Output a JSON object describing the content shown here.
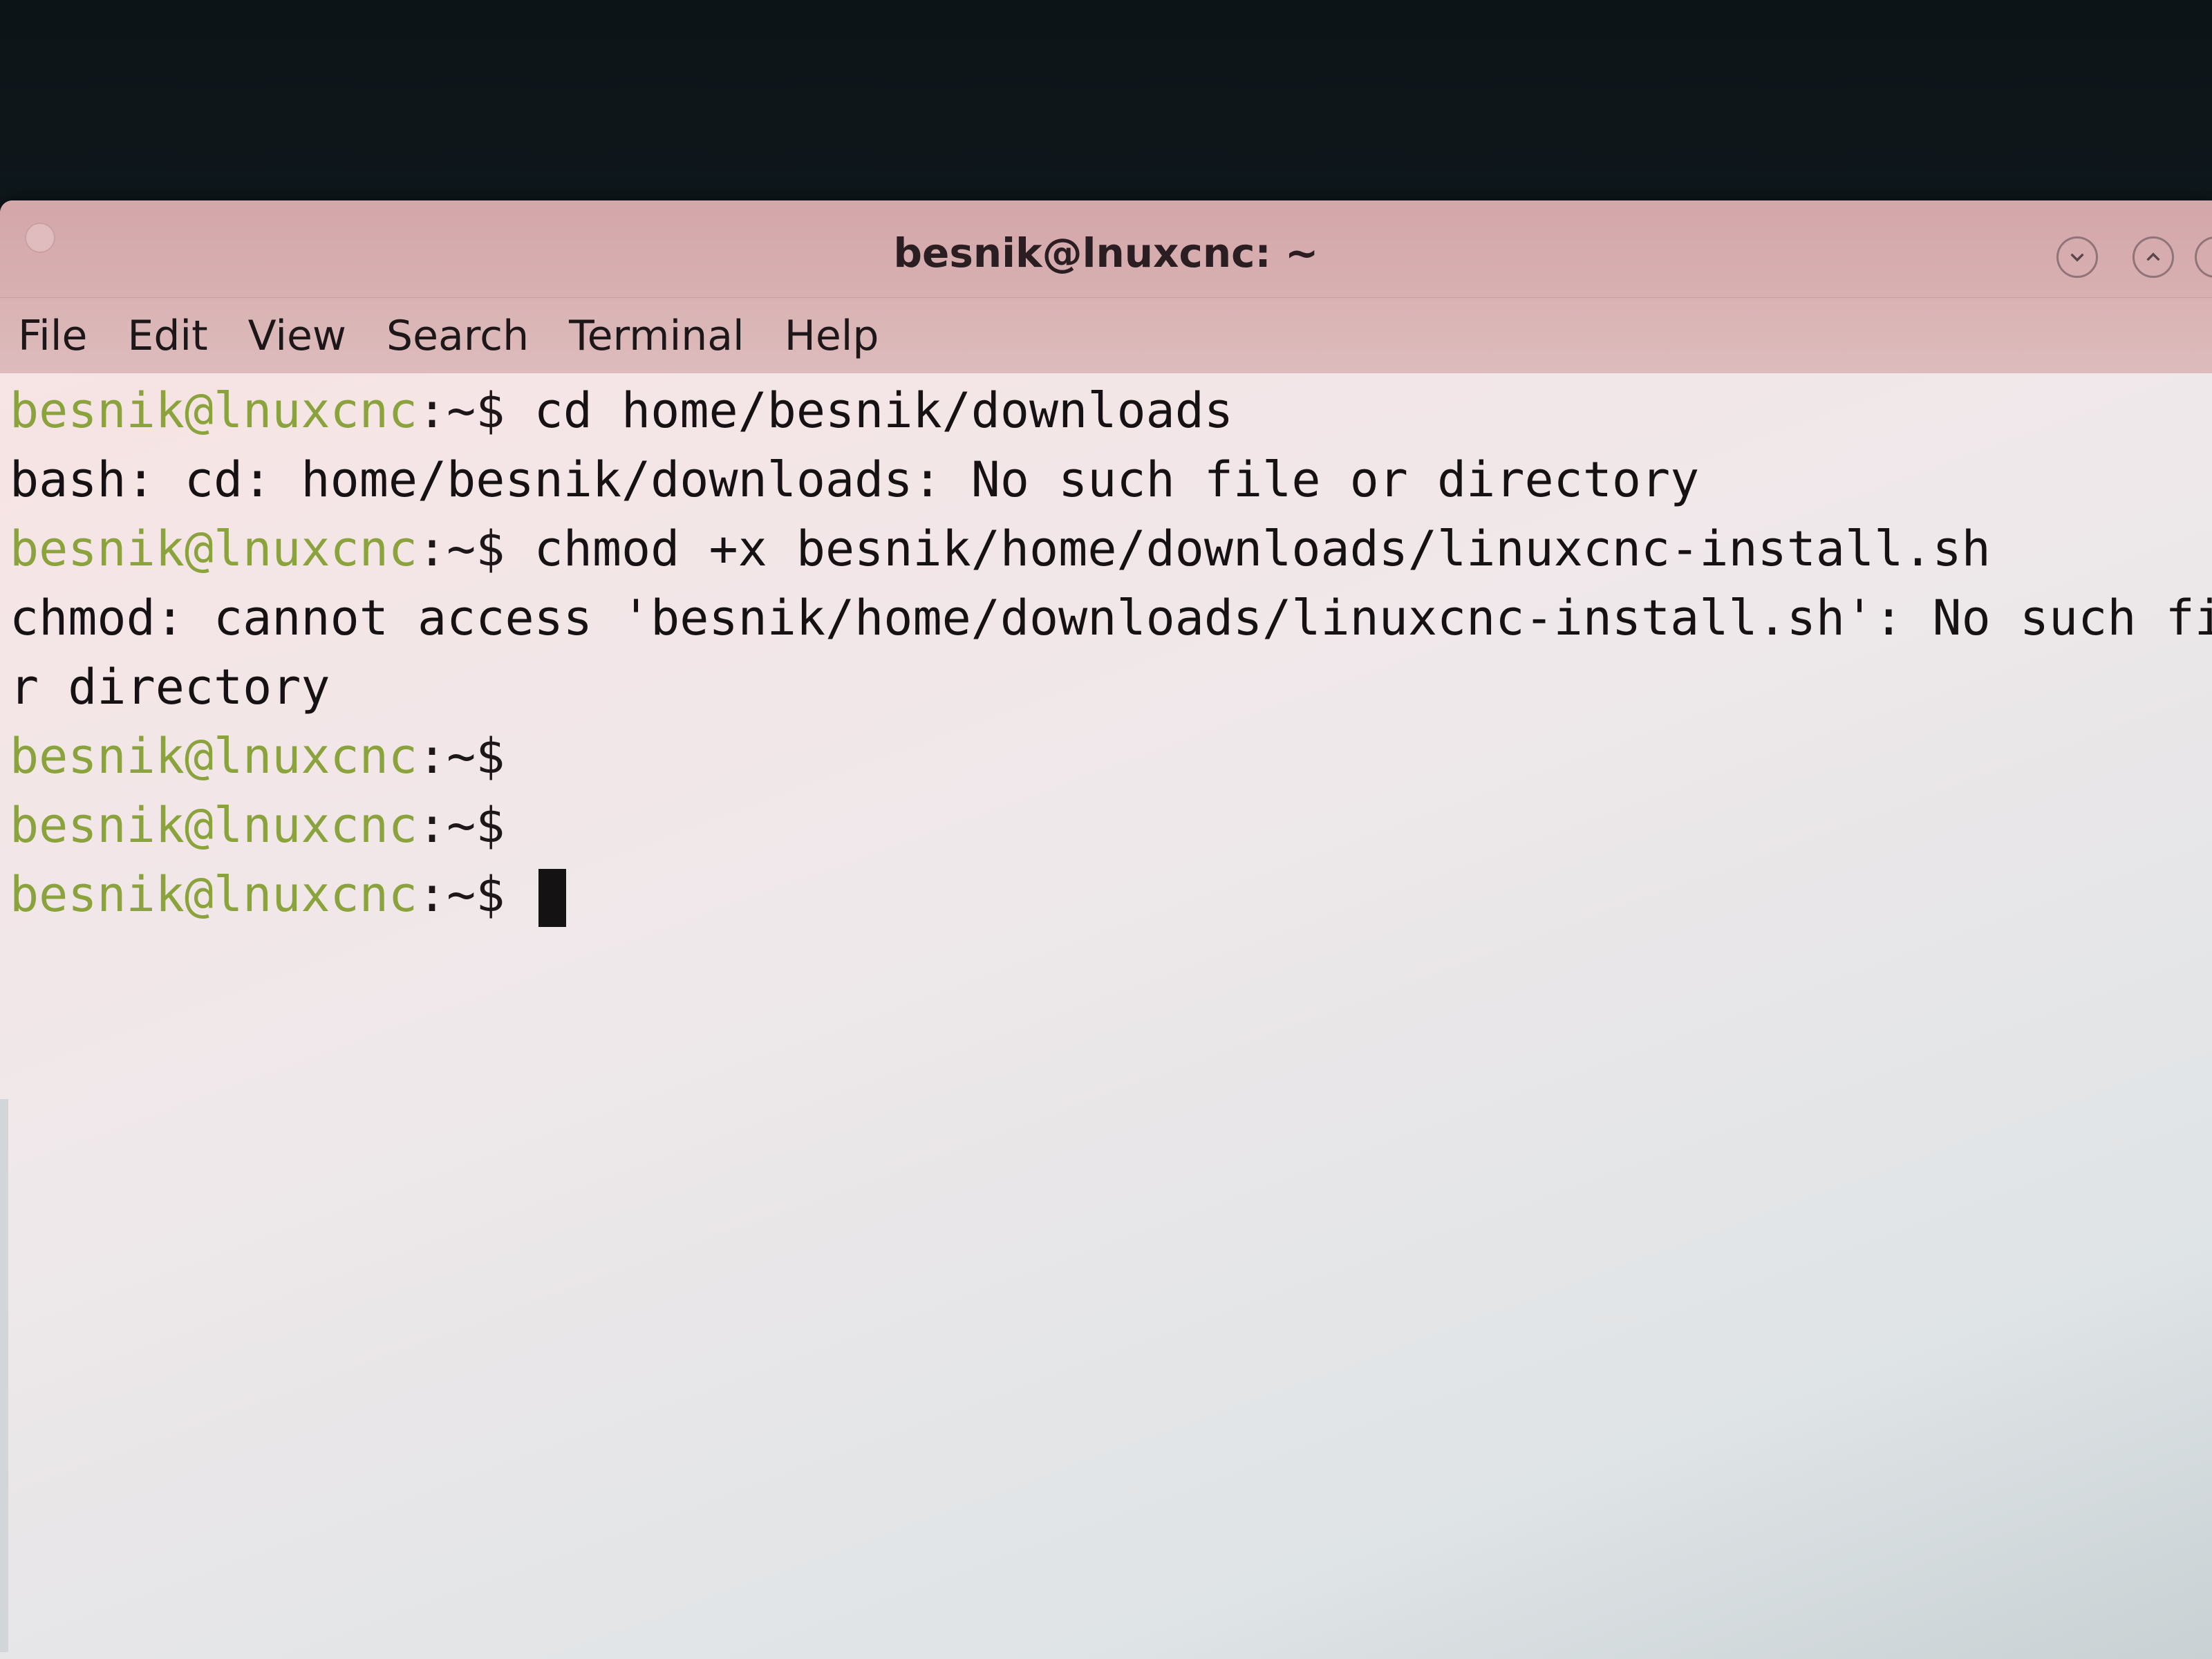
{
  "window": {
    "title": "besnik@lnuxcnc: ~"
  },
  "menu": {
    "items": [
      {
        "label": "File"
      },
      {
        "label": "Edit"
      },
      {
        "label": "View"
      },
      {
        "label": "Search"
      },
      {
        "label": "Terminal"
      },
      {
        "label": "Help"
      }
    ]
  },
  "terminal": {
    "prompt_user": "besnik@lnuxcnc",
    "prompt_suffix": ":~$",
    "lines": [
      {
        "type": "prompt",
        "command": " cd home/besnik/downloads"
      },
      {
        "type": "output",
        "text": "bash: cd: home/besnik/downloads: No such file or directory"
      },
      {
        "type": "prompt",
        "command": " chmod +x besnik/home/downloads/linuxcnc-install.sh"
      },
      {
        "type": "output",
        "text": "chmod: cannot access 'besnik/home/downloads/linuxcnc-install.sh': No such file o"
      },
      {
        "type": "output",
        "text": "r directory"
      },
      {
        "type": "prompt",
        "command": ""
      },
      {
        "type": "prompt",
        "command": ""
      },
      {
        "type": "prompt",
        "command": " "
      }
    ]
  },
  "colors": {
    "prompt_user": "#8aa33c",
    "text": "#161214",
    "titlebar": "#d4a7a9"
  }
}
